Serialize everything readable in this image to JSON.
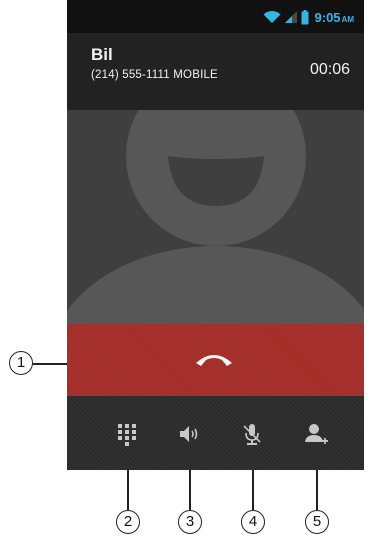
{
  "status_bar": {
    "time": "9:05",
    "ampm": "AM",
    "icons": [
      "wifi-icon",
      "signal-icon",
      "battery-icon"
    ]
  },
  "caller": {
    "name": "Bil",
    "number": "(214) 555-1111 MOBILE",
    "duration": "00:06"
  },
  "contact_photo": {
    "icon": "default-contact-silhouette"
  },
  "end_call": {
    "icon": "end-call-handset-icon",
    "color": "#a8312b"
  },
  "controls": [
    {
      "icon": "dialpad-icon",
      "callout": "2"
    },
    {
      "icon": "speaker-icon",
      "callout": "3"
    },
    {
      "icon": "mute-microphone-icon",
      "callout": "4"
    },
    {
      "icon": "add-call-icon",
      "callout": "5"
    }
  ],
  "callouts": {
    "end_call": "1"
  },
  "colors": {
    "accent": "#33b5e5",
    "end_call": "#a8312b",
    "icon": "#c8c8c8"
  }
}
